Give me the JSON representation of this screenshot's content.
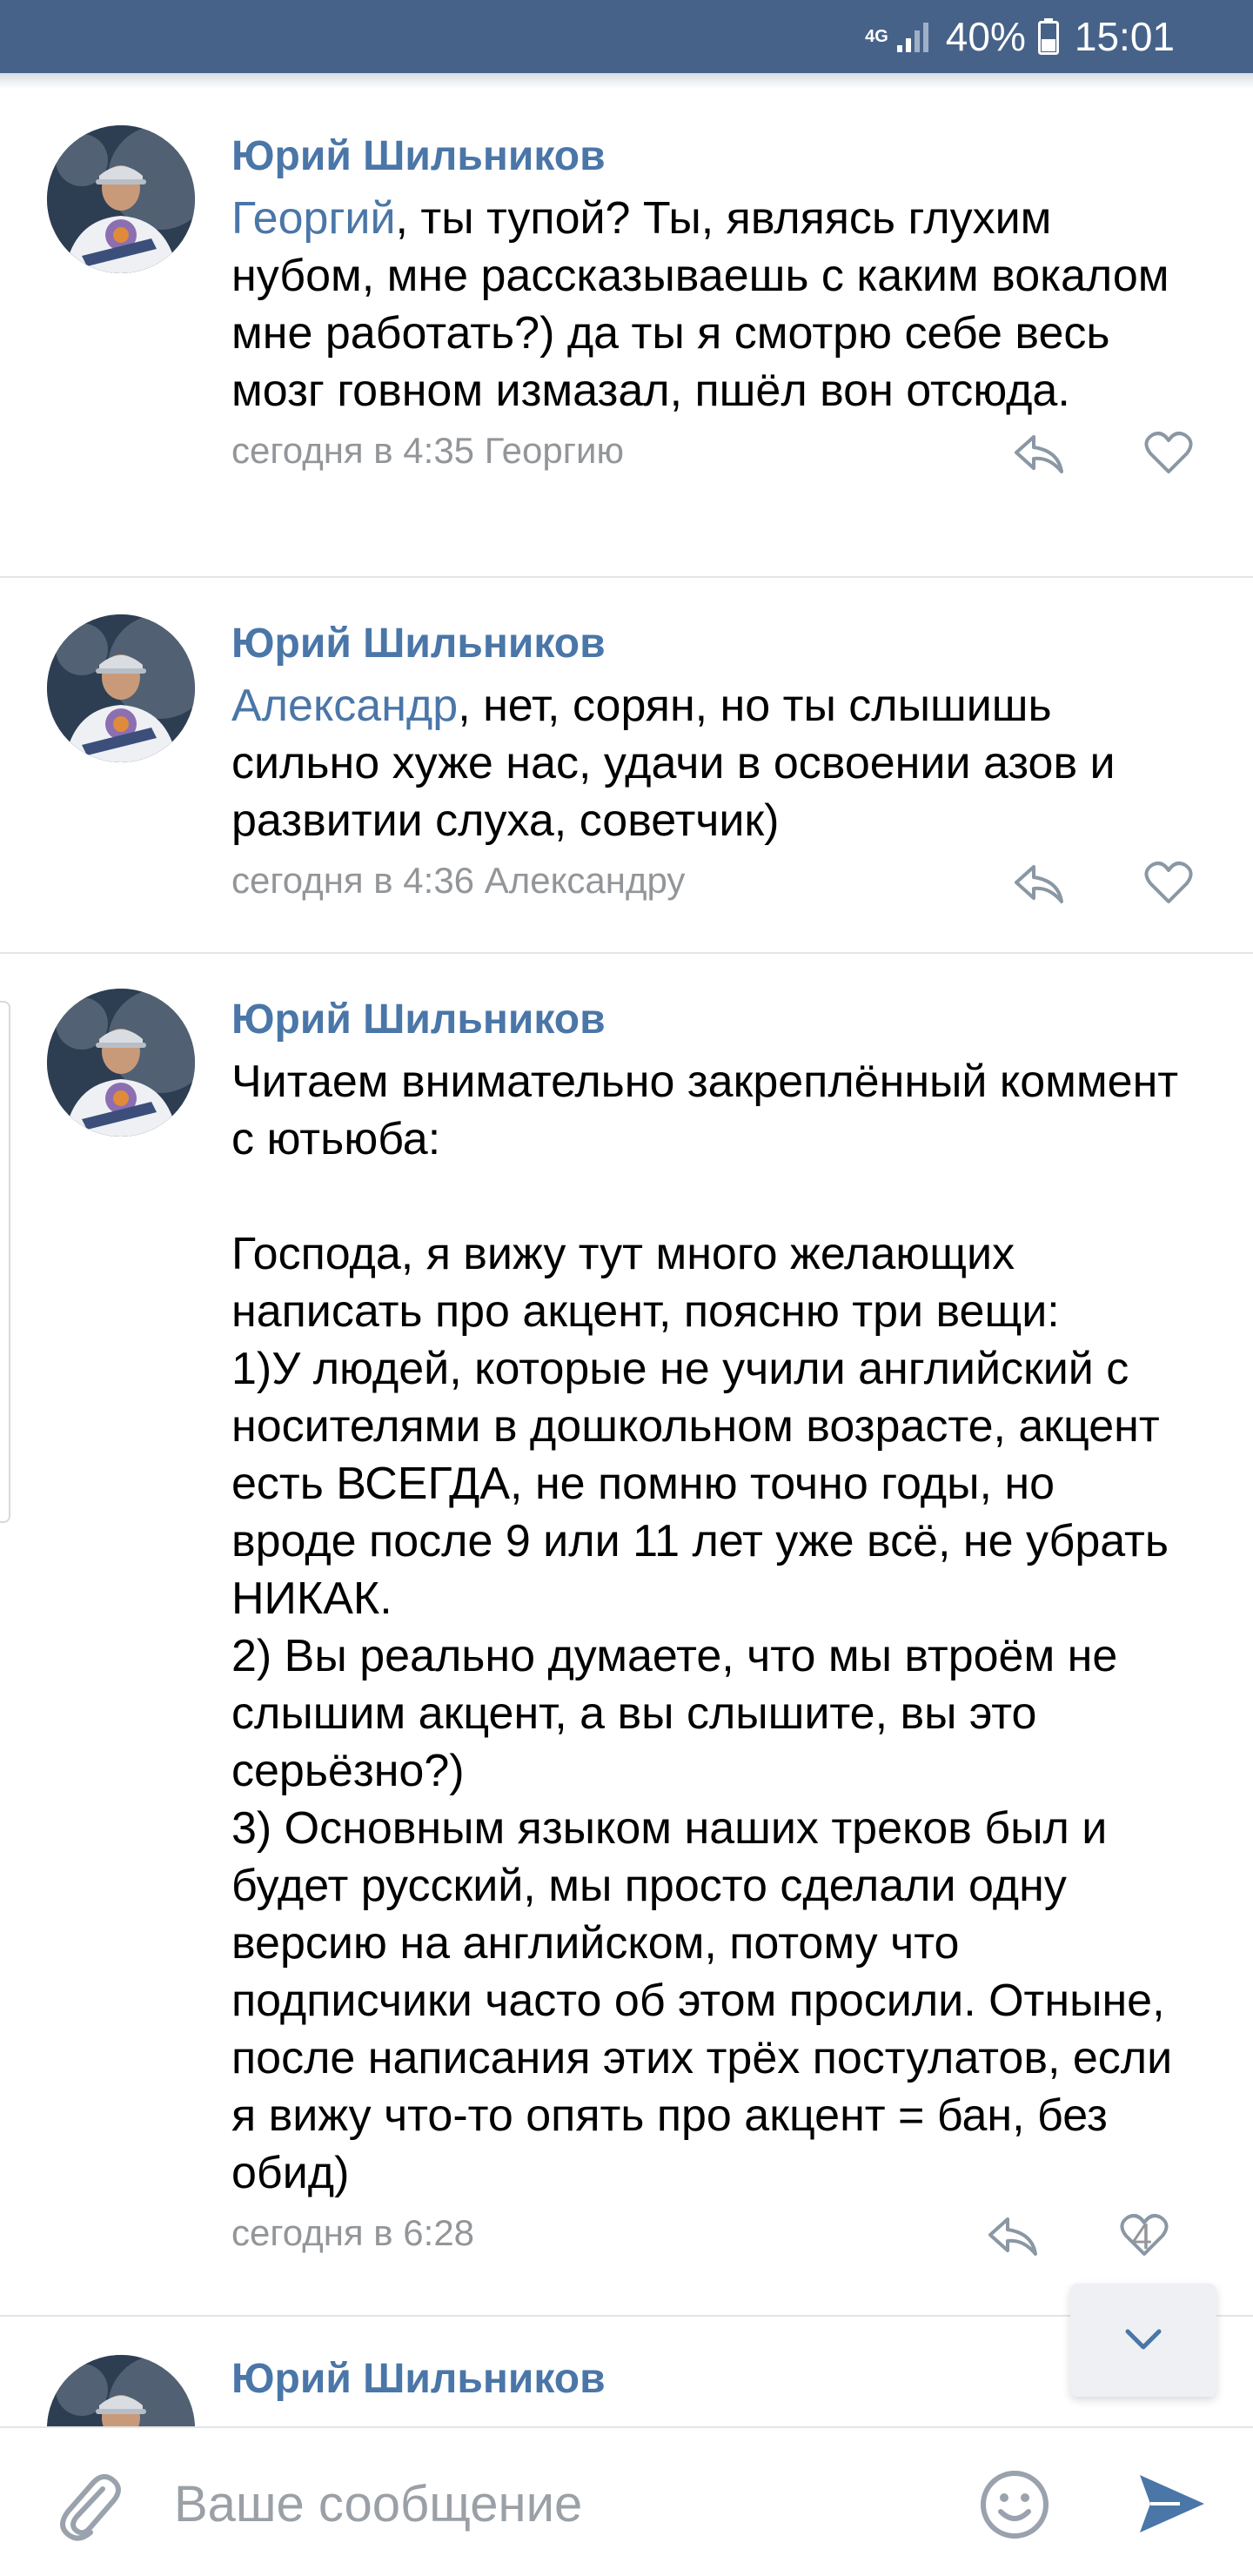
{
  "status_bar": {
    "network": "4G",
    "battery": "40%",
    "time": "15:01"
  },
  "comments": [
    {
      "author": "Юрий Шильников",
      "mention": "Георгий",
      "text": ", ты тупой? Ты, являясь глухим нубом, мне рассказываешь с каким вокалом мне работать?) да ты я смотрю себе весь мозг говном измазал, пшёл вон отсюда.",
      "meta": "сегодня в 4:35 Георгию"
    },
    {
      "author": "Юрий Шильников",
      "mention": "Александр",
      "text": ", нет, сорян, но ты слышишь сильно хуже нас, удачи в освоении азов и развитии слуха, советчик)",
      "meta": "сегодня в 4:36 Александру"
    },
    {
      "author": "Юрий Шильников",
      "text": "Читаем внимательно закреплённый коммент с ютьюба:\n\nГоспода, я вижу тут много желающих написать про акцент, поясню три вещи:\n1)У людей, которые не учили английский с носителями в дошкольном возрасте, акцент есть ВСЕГДА, не помню точно годы, но вроде после 9 или 11 лет уже всё, не убрать НИКАК.\n2) Вы реально думаете, что мы втроём не слышим акцент, а вы слышите, вы это серьёзно?)\n3) Основным языком наших треков был и будет русский, мы просто сделали одну версию на английском, потому что подписчики часто об этом просили. Отныне, после написания этих трёх постулатов, если я вижу что-то опять про акцент = бан, без обид)",
      "meta": "сегодня в 6:28",
      "likes": "4"
    },
    {
      "author": "Юрий Шильников"
    }
  ],
  "composer": {
    "placeholder": "Ваше сообщение"
  }
}
